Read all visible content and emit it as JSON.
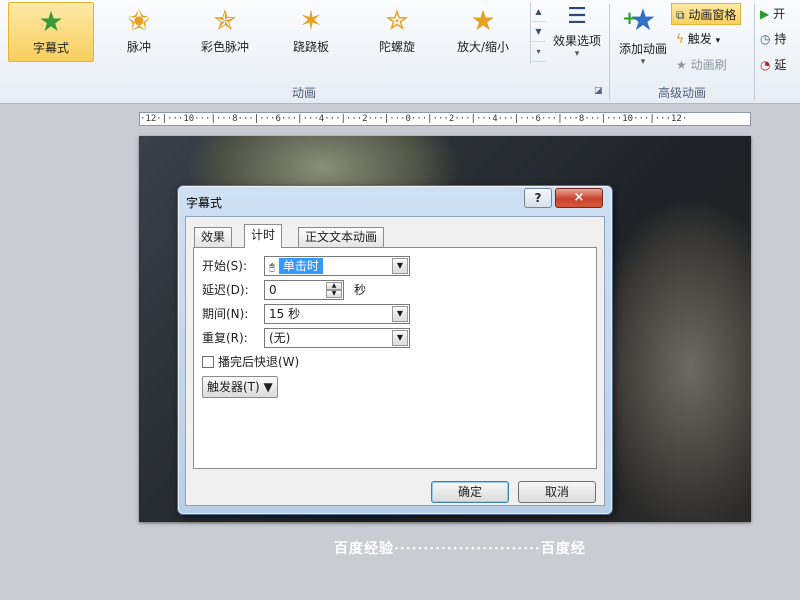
{
  "colors": {
    "accent": "#3399ff",
    "selected_bg": "#f8cf5f",
    "close": "#c8412a"
  },
  "ribbon": {
    "animations": [
      {
        "label": "字幕式",
        "icon": "green-star-icon",
        "color": "#3a9a3a",
        "selected": true
      },
      {
        "label": "脉冲",
        "icon": "gold-star-icon",
        "color": "#e6a21e"
      },
      {
        "label": "彩色脉冲",
        "icon": "gold-star-icon",
        "color": "#e6a21e"
      },
      {
        "label": "跷跷板",
        "icon": "gold-star-icon",
        "color": "#e6a21e"
      },
      {
        "label": "陀螺旋",
        "icon": "gold-star-icon",
        "color": "#e6a21e"
      },
      {
        "label": "放大/缩小",
        "icon": "gold-star-icon",
        "color": "#e6a21e"
      }
    ],
    "effects_options": "效果选项",
    "group_animation": "动画",
    "add_animation": "添加动画",
    "animation_pane": "动画窗格",
    "trigger": "触发",
    "animation_painter": "动画刷",
    "group_advanced": "高级动画",
    "timing": {
      "start": "开",
      "duration": "持",
      "delay": "延"
    }
  },
  "ruler": {
    "text": "·12·|···10···|···8···|···6···|···4···|···2···|···0···|···2···|···4···|···6···|···8···|···10···|···12·"
  },
  "watermark": "百度经验·························百度经",
  "dialog": {
    "title": "字幕式",
    "help_label": "?",
    "close_label": "×",
    "tabs": [
      "效果",
      "计时",
      "正文文本动画"
    ],
    "fields": {
      "start_label": "开始(S):",
      "start_value": "单击时",
      "delay_label": "延迟(D):",
      "delay_value": "0",
      "delay_unit": "秒",
      "duration_label": "期间(N):",
      "duration_value": "15 秒",
      "repeat_label": "重复(R):",
      "repeat_value": "(无)",
      "rewind_label": "播完后快退(W)",
      "rewind_checked": false,
      "triggers_label": "触发器(T) ▼"
    },
    "ok_label": "确定",
    "cancel_label": "取消"
  }
}
